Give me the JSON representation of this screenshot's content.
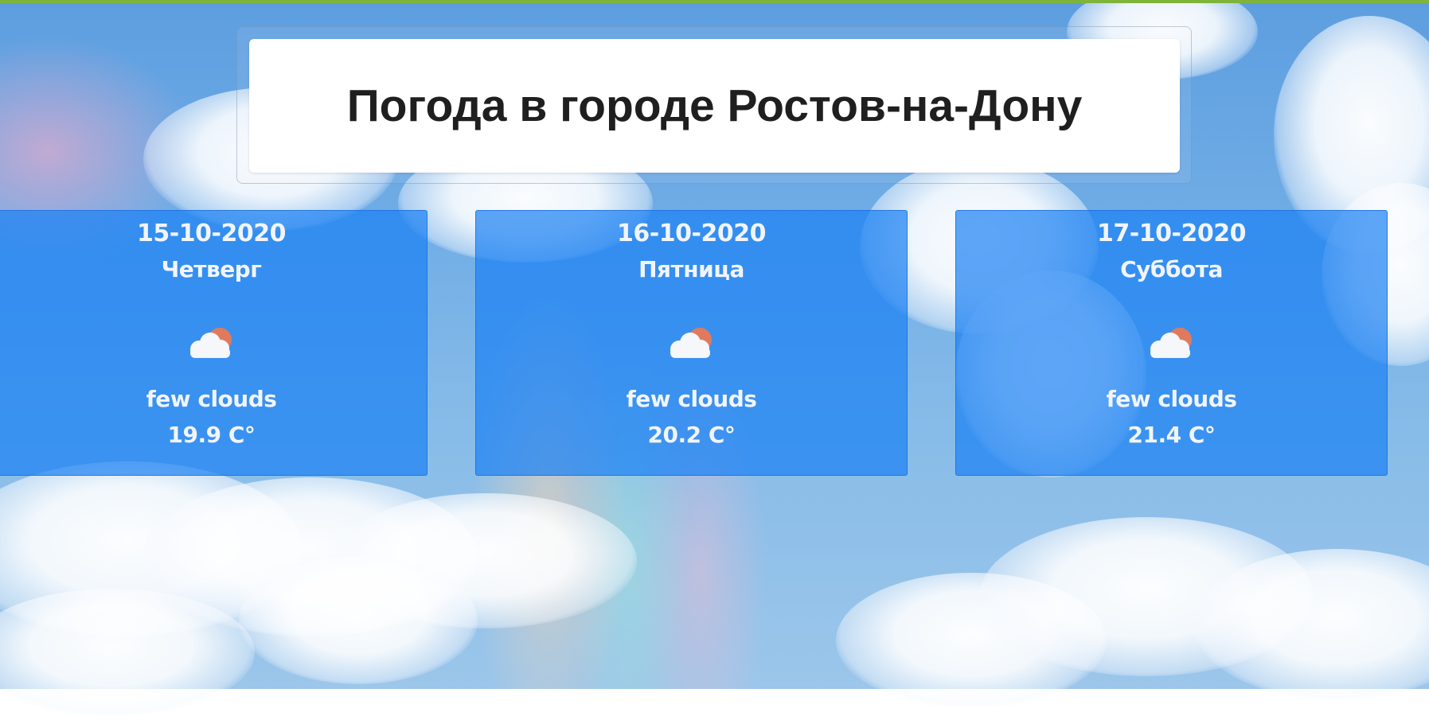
{
  "page": {
    "title": "Погода в городе Ростов-на-Дону",
    "accent_bar_color": "#7fb43a",
    "background": "sky-with-clouds-and-rainbow"
  },
  "forecast": [
    {
      "date": "15-10-2020",
      "weekday": "Четверг",
      "icon": "few-clouds-icon",
      "description": "few clouds",
      "temperature": "19.9 C°"
    },
    {
      "date": "16-10-2020",
      "weekday": "Пятница",
      "icon": "few-clouds-icon",
      "description": "few clouds",
      "temperature": "20.2 C°"
    },
    {
      "date": "17-10-2020",
      "weekday": "Суббота",
      "icon": "few-clouds-icon",
      "description": "few clouds",
      "temperature": "21.4 C°"
    }
  ],
  "colors": {
    "card_fill": "#1a80f4",
    "card_text": "#f1f5fb",
    "title_text": "#1f1f1f",
    "sun": "#e07a5f",
    "cloud": "#f5f7fa"
  }
}
